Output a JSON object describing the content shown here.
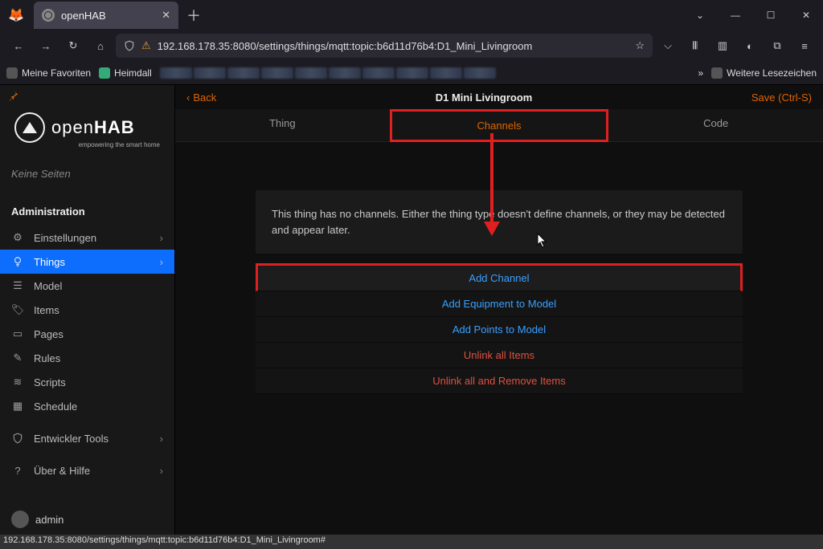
{
  "browser": {
    "tab_title": "openHAB",
    "url": "192.168.178.35:8080/settings/things/mqtt:topic:b6d11d76b4:D1_Mini_Livingroom",
    "status_url": "192.168.178.35:8080/settings/things/mqtt:topic:b6d11d76b4:D1_Mini_Livingroom#"
  },
  "bookmarks": {
    "fav": "Meine Favoriten",
    "heimdall": "Heimdall",
    "more": "Weitere Lesezeichen"
  },
  "sidebar": {
    "logo_main": "open",
    "logo_bold": "HAB",
    "logo_sub": "empowering the smart home",
    "no_pages": "Keine Seiten",
    "admin": "Administration",
    "settings": "Einstellungen",
    "things": "Things",
    "model": "Model",
    "items": "Items",
    "pages": "Pages",
    "rules": "Rules",
    "scripts": "Scripts",
    "schedule": "Schedule",
    "devtools": "Entwickler Tools",
    "about": "Über & Hilfe",
    "user": "admin"
  },
  "main": {
    "back": "Back",
    "title": "D1 Mini Livingroom",
    "save": "Save (Ctrl-S)",
    "tabs": {
      "thing": "Thing",
      "channels": "Channels",
      "code": "Code"
    },
    "message": "This thing has no channels. Either the thing type doesn't define channels, or they may be detected and appear later.",
    "actions": {
      "add_channel": "Add Channel",
      "add_equipment": "Add Equipment to Model",
      "add_points": "Add Points to Model",
      "unlink_all": "Unlink all Items",
      "unlink_remove": "Unlink all and Remove Items"
    }
  }
}
